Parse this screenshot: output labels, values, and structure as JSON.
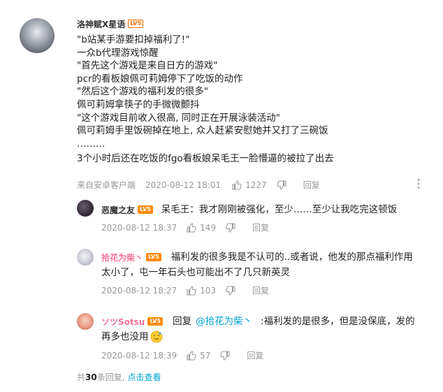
{
  "main_comment": {
    "username": "洛神赋X星语",
    "level": "LV5",
    "lines": [
      "\"b站某手游要扣掉福利了!\"",
      "一众b代理游戏惊醒",
      "\"首先这个游戏是来自日方的游戏\"",
      "pcr的看板娘佩可莉姆停下了吃饭的动作",
      "\"然后这个游戏的福利发的很多\"",
      "佩可莉姆拿筷子的手微微颤抖",
      "\"这个游戏目前收入很高, 同时正在开展泳装活动\"",
      "佩可莉姆手里饭碗掉在地上, 众人赶紧安慰她并又打了三碗饭",
      "………",
      "3个小时后还在吃饭的fgo看板娘呆毛王一脸懵逼的被拉了出去"
    ],
    "source": "来自安卓客户端",
    "time": "2020-08-12 18:01",
    "likes": "1227",
    "reply_label": "回复"
  },
  "replies": [
    {
      "username": "恶魔之友",
      "level": "LV5",
      "text": "呆毛王：我才刚刚被强化，至少……至少让我吃完这顿饭",
      "time": "2020-08-12 18:37",
      "likes": "149",
      "reply_label": "回复"
    },
    {
      "username": "拾花为柴丶",
      "level": "LV5",
      "text_line1": "福利发的很多我是不认可的..或者说，他发的那点福利作用",
      "text_line2": "太小了，屯一年石头也可能出不了几只新英灵",
      "time": "2020-08-12 18:27",
      "likes": "103",
      "reply_label": "回复"
    },
    {
      "username": "ソツSotsu",
      "level": "LV5",
      "reply_prefix": "回复",
      "mention": "@拾花为柴丶",
      "text_line1": ":福利发的是很多，但是没保底，发的",
      "text_line2": "再多也没用",
      "time": "2020-08-12 18:39",
      "likes": "57",
      "reply_label": "回复"
    }
  ],
  "footer": {
    "prefix": "共",
    "count": "30",
    "suffix": "条回复,",
    "view_link": "点击查看"
  },
  "colors": {
    "accent": "#00a1d6",
    "level_badge": "#ff6a00",
    "meta_gray": "#999999"
  },
  "icons": [
    "thumbs-up-icon",
    "thumbs-down-icon",
    "more-vertical-icon",
    "smiley-emoji-icon"
  ]
}
